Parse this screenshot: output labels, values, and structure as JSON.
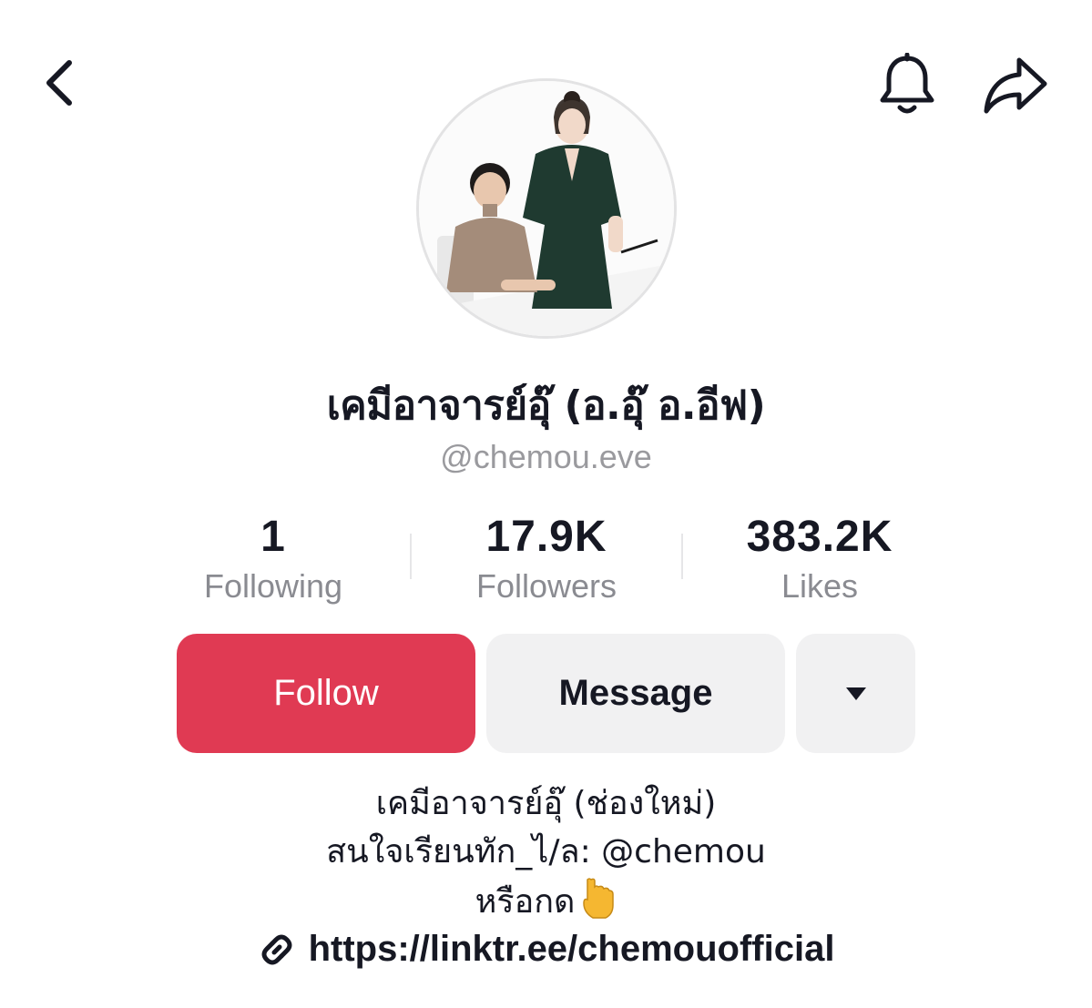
{
  "profile": {
    "display_name": "เคมีอาจารย์อุ๊ (อ.อุ๊ อ.อีฟ)",
    "username": "@chemou.eve"
  },
  "stats": [
    {
      "value": "1",
      "label": "Following"
    },
    {
      "value": "17.9K",
      "label": "Followers"
    },
    {
      "value": "383.2K",
      "label": "Likes"
    }
  ],
  "actions": {
    "follow_label": "Follow",
    "message_label": "Message"
  },
  "bio": {
    "lines": [
      "เคมีอาจารย์อุ๊ (ช่องใหม่)",
      "สนใจเรียนทัก_ไ/ล: @chemou",
      "หรือกด"
    ],
    "link": "https://linktr.ee/chemouofficial"
  },
  "icons": {
    "back": "back-chevron-icon",
    "bell": "bell-icon",
    "share": "share-arrow-icon",
    "more": "caret-down-icon",
    "link": "link-icon",
    "emoji": "pointing-down-hand-icon"
  },
  "colors": {
    "follow": "#e03a53",
    "secondary_button": "#f1f1f2",
    "muted_text": "#8a8b91"
  }
}
